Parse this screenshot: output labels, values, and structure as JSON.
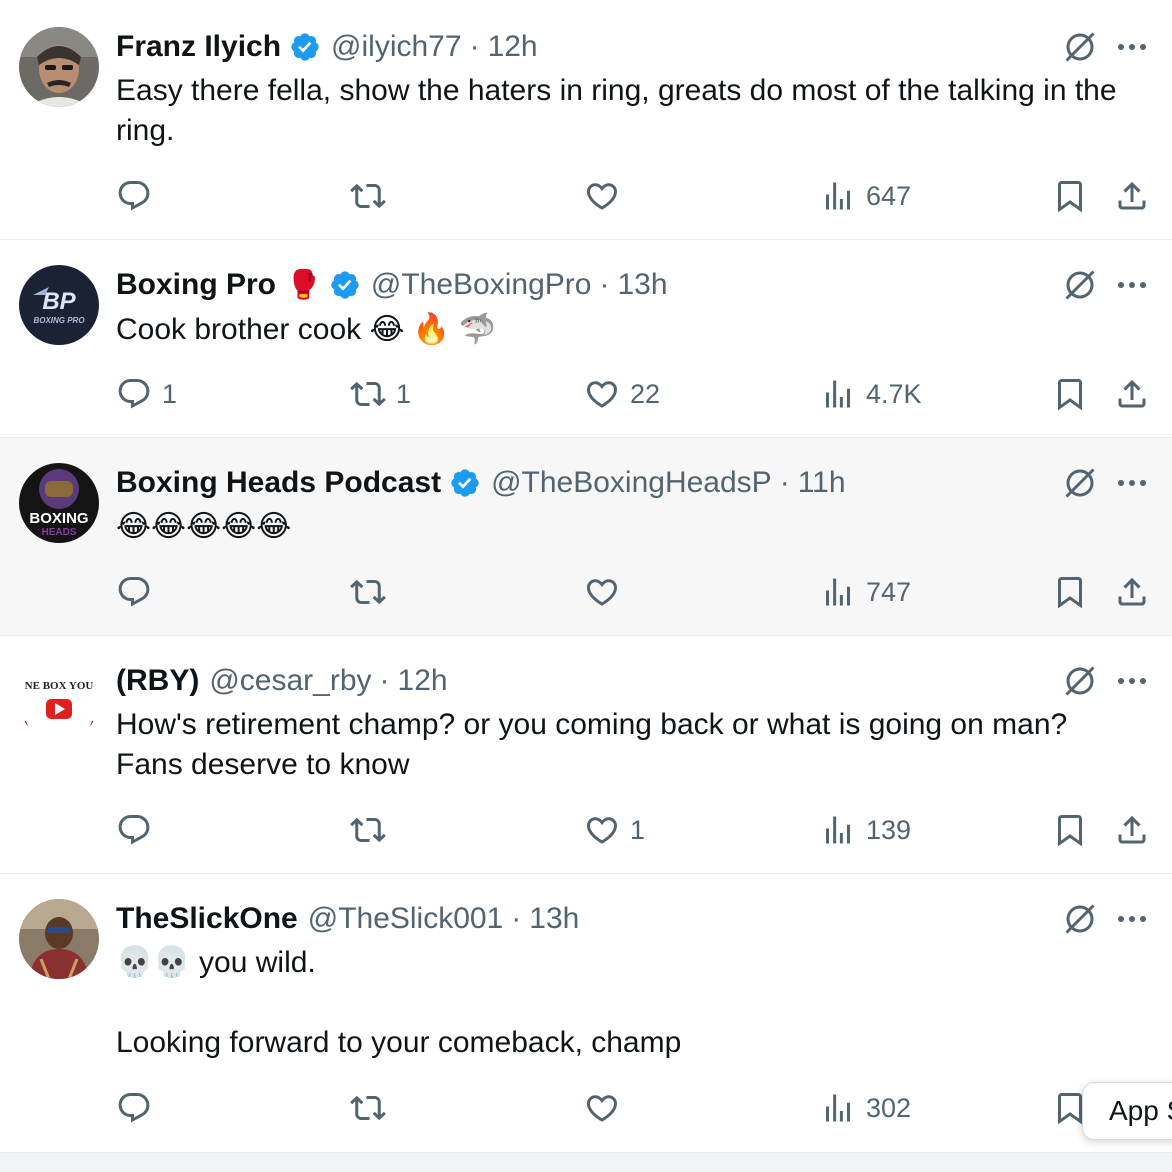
{
  "tweets": [
    {
      "name": "Franz Ilyich",
      "verified": true,
      "name_emoji": "",
      "handle": "@ilyich77",
      "separator": "·",
      "time": "12h",
      "text": "Easy there fella, show the haters in ring, greats do most of the talking in the\nring.",
      "stats": {
        "replies": "",
        "reposts": "",
        "likes": "",
        "views": "647"
      }
    },
    {
      "name": "Boxing Pro",
      "verified": true,
      "name_emoji": "🥊",
      "handle": "@TheBoxingPro",
      "separator": "·",
      "time": "13h",
      "text": "Cook brother cook 😂 🔥 🦈",
      "stats": {
        "replies": "1",
        "reposts": "1",
        "likes": "22",
        "views": "4.7K"
      }
    },
    {
      "name": "Boxing Heads Podcast",
      "verified": true,
      "name_emoji": "",
      "handle": "@TheBoxingHeadsP",
      "separator": "·",
      "time": "11h",
      "text": "😂😂😂😂😂",
      "stats": {
        "replies": "",
        "reposts": "",
        "likes": "",
        "views": "747"
      }
    },
    {
      "name": "(RBY)",
      "verified": false,
      "name_emoji": "",
      "handle": "@cesar_rby",
      "separator": "·",
      "time": "12h",
      "text": "How's retirement champ? or you coming back or what is going on man?\nFans deserve to know",
      "stats": {
        "replies": "",
        "reposts": "",
        "likes": "1",
        "views": "139"
      }
    },
    {
      "name": "TheSlickOne",
      "verified": false,
      "name_emoji": "",
      "handle": "@TheSlick001",
      "separator": "·",
      "time": "13h",
      "text": "💀💀 you wild.\n\nLooking forward to your comeback, champ",
      "stats": {
        "replies": "",
        "reposts": "",
        "likes": "",
        "views": "302"
      }
    }
  ],
  "avatars": {
    "boxing_pro_logo": "BP",
    "boxing_pro_sub": "BOXING PRO",
    "boxing_heads_logo": "BOXING",
    "boxing_heads_sub": "HEADS",
    "rby_logo": "NE BOX YOU"
  },
  "app_pill": {
    "label": "App S"
  },
  "colors": {
    "text": "#0f1419",
    "secondary": "#536471",
    "verified": "#1d9bf0",
    "divider": "#e6ecf0",
    "highlight_bg": "#f7f7f7"
  },
  "icons": [
    "reply-icon",
    "repost-icon",
    "like-icon",
    "views-icon",
    "bookmark-icon",
    "share-icon",
    "grok-icon",
    "more-icon",
    "verified-badge-icon"
  ]
}
